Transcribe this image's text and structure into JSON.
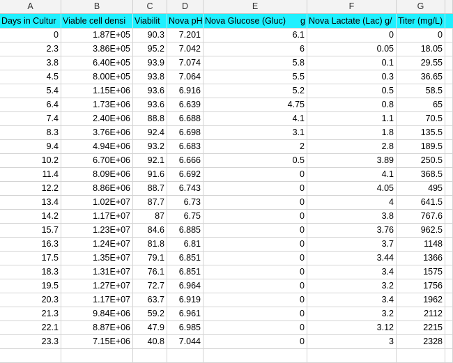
{
  "column_letters": [
    "A",
    "B",
    "C",
    "D",
    "E",
    "F",
    "G"
  ],
  "headers": {
    "A": "Days in Cultur",
    "B": "Viable cell densi",
    "C": "Viabilit",
    "D": "Nova pH",
    "E": "Nova Glucose (Gluc)",
    "E_suffix": "g",
    "F": "Nova Lactate (Lac) g/",
    "G": "Titer (mg/L)"
  },
  "rows": [
    [
      "0",
      "1.87E+05",
      "90.3",
      "7.201",
      "6.1",
      "0",
      "0"
    ],
    [
      "2.3",
      "3.86E+05",
      "95.2",
      "7.042",
      "6",
      "0.05",
      "18.05"
    ],
    [
      "3.8",
      "6.40E+05",
      "93.9",
      "7.074",
      "5.8",
      "0.1",
      "29.55"
    ],
    [
      "4.5",
      "8.00E+05",
      "93.8",
      "7.064",
      "5.5",
      "0.3",
      "36.65"
    ],
    [
      "5.4",
      "1.15E+06",
      "93.6",
      "6.916",
      "5.2",
      "0.5",
      "58.5"
    ],
    [
      "6.4",
      "1.73E+06",
      "93.6",
      "6.639",
      "4.75",
      "0.8",
      "65"
    ],
    [
      "7.4",
      "2.40E+06",
      "88.8",
      "6.688",
      "4.1",
      "1.1",
      "70.5"
    ],
    [
      "8.3",
      "3.76E+06",
      "92.4",
      "6.698",
      "3.1",
      "1.8",
      "135.5"
    ],
    [
      "9.4",
      "4.94E+06",
      "93.2",
      "6.683",
      "2",
      "2.8",
      "189.5"
    ],
    [
      "10.2",
      "6.70E+06",
      "92.1",
      "6.666",
      "0.5",
      "3.89",
      "250.5"
    ],
    [
      "11.4",
      "8.09E+06",
      "91.6",
      "6.692",
      "0",
      "4.1",
      "368.5"
    ],
    [
      "12.2",
      "8.86E+06",
      "88.7",
      "6.743",
      "0",
      "4.05",
      "495"
    ],
    [
      "13.4",
      "1.02E+07",
      "87.7",
      "6.73",
      "0",
      "4",
      "641.5"
    ],
    [
      "14.2",
      "1.17E+07",
      "87",
      "6.75",
      "0",
      "3.8",
      "767.6"
    ],
    [
      "15.7",
      "1.23E+07",
      "84.6",
      "6.885",
      "0",
      "3.76",
      "962.5"
    ],
    [
      "16.3",
      "1.24E+07",
      "81.8",
      "6.81",
      "0",
      "3.7",
      "1148"
    ],
    [
      "17.5",
      "1.35E+07",
      "79.1",
      "6.851",
      "0",
      "3.44",
      "1366"
    ],
    [
      "18.3",
      "1.31E+07",
      "76.1",
      "6.851",
      "0",
      "3.4",
      "1575"
    ],
    [
      "19.5",
      "1.27E+07",
      "72.7",
      "6.964",
      "0",
      "3.2",
      "1756"
    ],
    [
      "20.3",
      "1.17E+07",
      "63.7",
      "6.919",
      "0",
      "3.4",
      "1962"
    ],
    [
      "21.3",
      "9.84E+06",
      "59.2",
      "6.961",
      "0",
      "3.2",
      "2112"
    ],
    [
      "22.1",
      "8.87E+06",
      "47.9",
      "6.985",
      "0",
      "3.12",
      "2215"
    ],
    [
      "23.3",
      "7.15E+06",
      "40.8",
      "7.044",
      "0",
      "3",
      "2328"
    ]
  ]
}
